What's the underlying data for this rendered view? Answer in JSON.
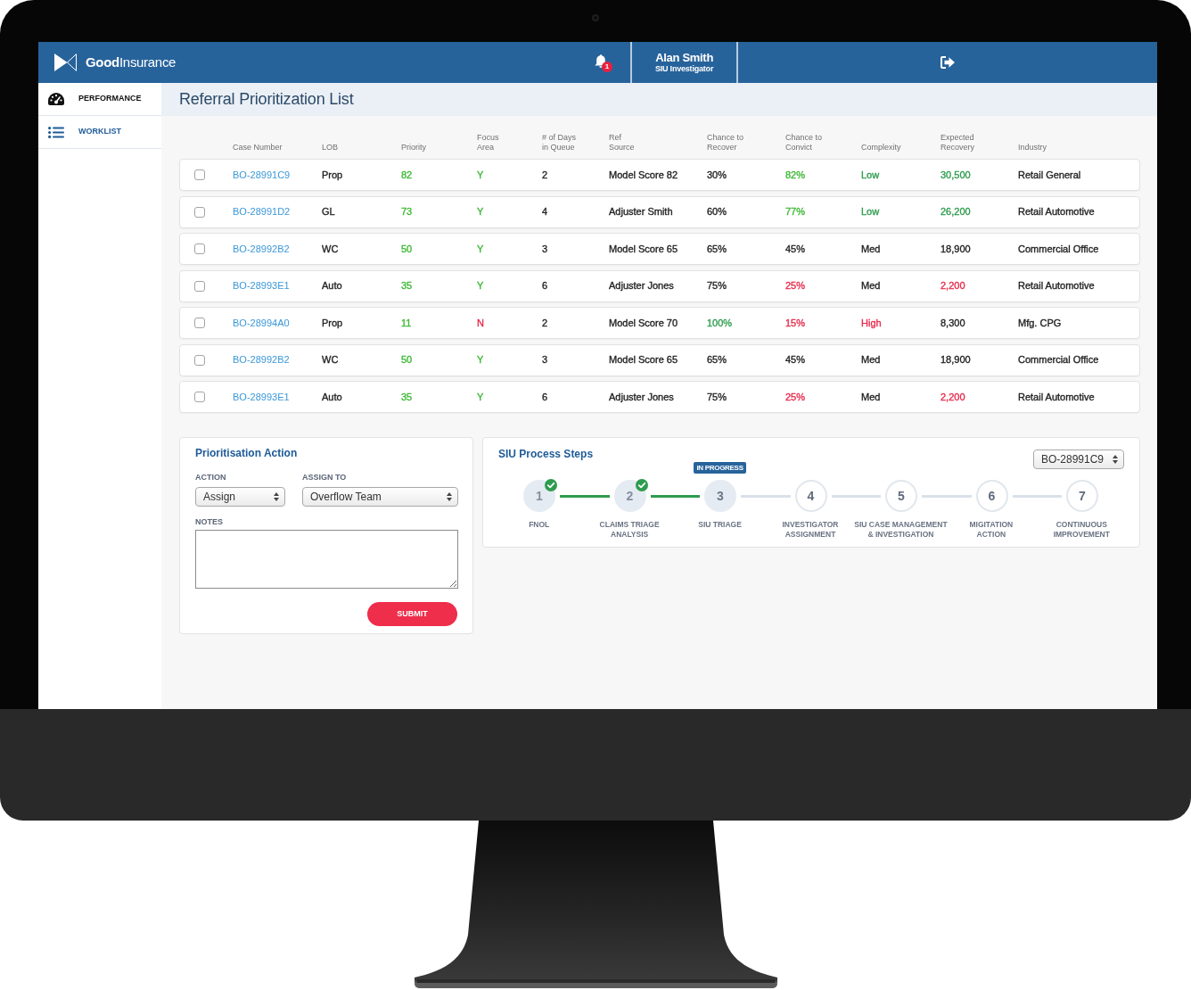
{
  "header": {
    "logo": "**Good**Insurance",
    "notification_count": "1",
    "user": {
      "name": "Alan Smith",
      "role": "SIU Investigator"
    }
  },
  "sidebar": {
    "items": [
      {
        "label": "PERFORMANCE",
        "selected": false
      },
      {
        "label": "WORKLIST",
        "selected": true
      }
    ]
  },
  "page_title": "Referral Prioritization List",
  "table": {
    "columns": [
      "Case Number",
      "LOB",
      "Priority",
      "Focus\nArea",
      "# of Days\nin Queue",
      "Ref\nSource",
      "Chance to\nRecover",
      "Chance to\nConvict",
      "Complexity",
      "Expected\nRecovery",
      "Industry"
    ],
    "rows": [
      {
        "checked": false,
        "cells": [
          {
            "text": "BO-28991C9"
          },
          {
            "text": "Prop"
          },
          {
            "text": "82",
            "color": "#3db835"
          },
          {
            "text": "Y",
            "color": "#3db835"
          },
          {
            "text": "2"
          },
          {
            "text": "Model Score 82"
          },
          {
            "text": "30%"
          },
          {
            "text": "82%",
            "color": "#3db835"
          },
          {
            "text": "Low",
            "color": "#2e9c4e"
          },
          {
            "text": "30,500",
            "color": "#2e9c4e"
          },
          {
            "text": "Retail General"
          }
        ]
      },
      {
        "checked": false,
        "cells": [
          {
            "text": "BO-28991D2"
          },
          {
            "text": "GL"
          },
          {
            "text": "73",
            "color": "#3db835"
          },
          {
            "text": "Y",
            "color": "#3db835"
          },
          {
            "text": "4"
          },
          {
            "text": "Adjuster Smith"
          },
          {
            "text": "60%"
          },
          {
            "text": "77%",
            "color": "#3db835"
          },
          {
            "text": "Low",
            "color": "#2e9c4e"
          },
          {
            "text": "26,200",
            "color": "#2e9c4e"
          },
          {
            "text": "Retail Automotive"
          }
        ]
      },
      {
        "checked": false,
        "cells": [
          {
            "text": "BO-28992B2"
          },
          {
            "text": "WC"
          },
          {
            "text": "50",
            "color": "#3db835"
          },
          {
            "text": "Y",
            "color": "#3db835"
          },
          {
            "text": "3"
          },
          {
            "text": "Model Score 65"
          },
          {
            "text": "65%"
          },
          {
            "text": "45%"
          },
          {
            "text": "Med"
          },
          {
            "text": "18,900"
          },
          {
            "text": "Commercial Office"
          }
        ]
      },
      {
        "checked": false,
        "cells": [
          {
            "text": "BO-28993E1"
          },
          {
            "text": "Auto"
          },
          {
            "text": "35",
            "color": "#3db835"
          },
          {
            "text": "Y",
            "color": "#3db835"
          },
          {
            "text": "6"
          },
          {
            "text": "Adjuster Jones"
          },
          {
            "text": "75%"
          },
          {
            "text": "25%",
            "color": "#e8284a"
          },
          {
            "text": "Med"
          },
          {
            "text": "2,200",
            "color": "#e8284a"
          },
          {
            "text": "Retail Automotive"
          }
        ]
      },
      {
        "checked": false,
        "cells": [
          {
            "text": "BO-28994A0"
          },
          {
            "text": "Prop"
          },
          {
            "text": "11",
            "color": "#3db835"
          },
          {
            "text": "N",
            "color": "#e8284a"
          },
          {
            "text": "2"
          },
          {
            "text": "Model Score 70"
          },
          {
            "text": "100%",
            "color": "#2e9c4e"
          },
          {
            "text": "15%",
            "color": "#e8284a"
          },
          {
            "text": "High",
            "color": "#e8284a"
          },
          {
            "text": "8,300"
          },
          {
            "text": "Mfg. CPG"
          }
        ]
      },
      {
        "checked": false,
        "cells": [
          {
            "text": "BO-28992B2"
          },
          {
            "text": "WC"
          },
          {
            "text": "50",
            "color": "#3db835"
          },
          {
            "text": "Y",
            "color": "#3db835"
          },
          {
            "text": "3"
          },
          {
            "text": "Model Score 65"
          },
          {
            "text": "65%"
          },
          {
            "text": "45%"
          },
          {
            "text": "Med"
          },
          {
            "text": "18,900"
          },
          {
            "text": "Commercial Office"
          }
        ]
      },
      {
        "checked": false,
        "cells": [
          {
            "text": "BO-28993E1"
          },
          {
            "text": "Auto"
          },
          {
            "text": "35",
            "color": "#3db835"
          },
          {
            "text": "Y",
            "color": "#3db835"
          },
          {
            "text": "6"
          },
          {
            "text": "Adjuster Jones"
          },
          {
            "text": "75%"
          },
          {
            "text": "25%",
            "color": "#e8284a"
          },
          {
            "text": "Med"
          },
          {
            "text": "2,200",
            "color": "#e8284a"
          },
          {
            "text": "Retail Automotive"
          }
        ]
      }
    ]
  },
  "prioritisation": {
    "title": "Prioritisation Action",
    "fields": [
      {
        "kind": "select",
        "label": "ACTION",
        "value": "Assign"
      },
      {
        "kind": "select",
        "label": "ASSIGN TO",
        "value": "Overflow Team"
      },
      {
        "kind": "textarea",
        "label": "NOTES"
      }
    ],
    "submit": "SUBMIT"
  },
  "siu_process": {
    "title": "SIU Process Steps",
    "case_select": "BO-28991C9",
    "steps": [
      {
        "number": "1",
        "label": "FNOL",
        "completed": true,
        "in_progress": false
      },
      {
        "number": "2",
        "label": "CLAIMS TRIAGE\nANALYSIS",
        "completed": true,
        "in_progress": false
      },
      {
        "number": "3",
        "label": "SIU TRIAGE",
        "completed": false,
        "in_progress": true,
        "badge": "IN PROGRESS"
      },
      {
        "number": "4",
        "label": "INVESTIGATOR\nASSIGNMENT",
        "completed": false,
        "in_progress": false
      },
      {
        "number": "5",
        "label": "SIU CASE MANAGEMENT\n& INVESTIGATION",
        "completed": false,
        "in_progress": false
      },
      {
        "number": "6",
        "label": "MIGITATION\nACTION",
        "completed": false,
        "in_progress": false
      },
      {
        "number": "7",
        "label": "CONTINUOUS\nIMPROVEMENT",
        "completed": false,
        "in_progress": false
      }
    ]
  }
}
